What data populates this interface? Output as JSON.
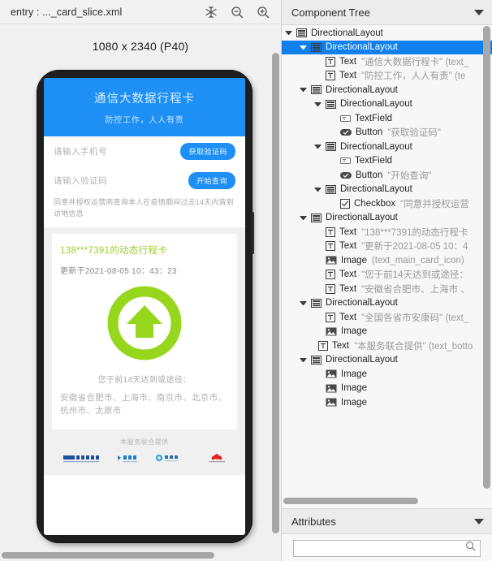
{
  "left_panel": {
    "title": "entry : ..._card_slice.xml",
    "toolbar_icons": [
      {
        "name": "snowflake-icon",
        "label": "snowflake"
      },
      {
        "name": "zoom-out-icon",
        "label": "zoom out"
      },
      {
        "name": "zoom-in-icon",
        "label": "zoom in"
      }
    ],
    "device_label": "1080 x 2340 (P40)",
    "preview": {
      "header_title": "通信大数据行程卡",
      "header_subtitle": "防控工作，人人有责",
      "phone_placeholder": "请输入手机号",
      "get_code_button": "获取验证码",
      "code_placeholder": "请输入验证码",
      "query_button": "开始查询",
      "agreement": "同意并授权运营商查询本人在疫情期间过去14天内曾到访地信息",
      "card_title": "138***7391的动态行程卡",
      "card_updated": "更新于2021-08-05 10：43：23",
      "card_icon": "green-up-arrow-icon",
      "result_text": "您于前14天达到或途径：",
      "cities": "安徽省合肥市、上海市、南京市、北京市、杭州市、太原市",
      "provider_label": "本服务联合提供",
      "logos": [
        "CAICT 中国信通院",
        "中国电信",
        "中国移动",
        "中国联通"
      ]
    }
  },
  "right_panel": {
    "header_title": "Component Tree",
    "attributes_title": "Attributes",
    "attributes_search_value": "",
    "attributes_search_placeholder": "",
    "tree": [
      {
        "indent": 0,
        "arrow": true,
        "icon": "layout",
        "label": "DirectionalLayout",
        "value": "",
        "selected": false
      },
      {
        "indent": 1,
        "arrow": true,
        "icon": "layout",
        "label": "DirectionalLayout",
        "value": "",
        "selected": true
      },
      {
        "indent": 2,
        "arrow": false,
        "icon": "text",
        "label": "Text",
        "value": "\"通信大数据行程卡\" (text_",
        "selected": false
      },
      {
        "indent": 2,
        "arrow": false,
        "icon": "text",
        "label": "Text",
        "value": "\"防控工作，人人有责\" (te",
        "selected": false
      },
      {
        "indent": 1,
        "arrow": true,
        "icon": "layout",
        "label": "DirectionalLayout",
        "value": "",
        "selected": false
      },
      {
        "indent": 2,
        "arrow": true,
        "icon": "layout",
        "label": "DirectionalLayout",
        "value": "",
        "selected": false
      },
      {
        "indent": 3,
        "arrow": false,
        "icon": "field",
        "label": "TextField",
        "value": "",
        "selected": false
      },
      {
        "indent": 3,
        "arrow": false,
        "icon": "button",
        "label": "Button",
        "value": "\"获取验证码\"",
        "selected": false
      },
      {
        "indent": 2,
        "arrow": true,
        "icon": "layout",
        "label": "DirectionalLayout",
        "value": "",
        "selected": false
      },
      {
        "indent": 3,
        "arrow": false,
        "icon": "field",
        "label": "TextField",
        "value": "",
        "selected": false
      },
      {
        "indent": 3,
        "arrow": false,
        "icon": "button",
        "label": "Button",
        "value": "\"开始查询\"",
        "selected": false
      },
      {
        "indent": 2,
        "arrow": true,
        "icon": "layout",
        "label": "DirectionalLayout",
        "value": "",
        "selected": false
      },
      {
        "indent": 3,
        "arrow": false,
        "icon": "check",
        "label": "Checkbox",
        "value": "\"同意并授权运营",
        "selected": false
      },
      {
        "indent": 1,
        "arrow": true,
        "icon": "layout",
        "label": "DirectionalLayout",
        "value": "",
        "selected": false
      },
      {
        "indent": 2,
        "arrow": false,
        "icon": "text",
        "label": "Text",
        "value": "\"138***7391的动态行程卡",
        "selected": false
      },
      {
        "indent": 2,
        "arrow": false,
        "icon": "text",
        "label": "Text",
        "value": "\"更新于2021-08-05 10：4",
        "selected": false
      },
      {
        "indent": 2,
        "arrow": false,
        "icon": "image",
        "label": "Image",
        "value": "(text_main_card_icon)",
        "selected": false
      },
      {
        "indent": 2,
        "arrow": false,
        "icon": "text",
        "label": "Text",
        "value": "\"您于前14天达到或途径：",
        "selected": false
      },
      {
        "indent": 2,
        "arrow": false,
        "icon": "text",
        "label": "Text",
        "value": "\"安徽省合肥市、上海市 、",
        "selected": false
      },
      {
        "indent": 1,
        "arrow": true,
        "icon": "layout",
        "label": "DirectionalLayout",
        "value": "",
        "selected": false
      },
      {
        "indent": 2,
        "arrow": false,
        "icon": "text",
        "label": "Text",
        "value": "\"全国各省市安康码\" (text_",
        "selected": false
      },
      {
        "indent": 2,
        "arrow": false,
        "icon": "image",
        "label": "Image",
        "value": "",
        "selected": false
      },
      {
        "indent": 1.5,
        "arrow": false,
        "icon": "text",
        "label": "Text",
        "value": "\"本服务联合提供\" (text_botto",
        "selected": false
      },
      {
        "indent": 1,
        "arrow": true,
        "icon": "layout",
        "label": "DirectionalLayout",
        "value": "",
        "selected": false
      },
      {
        "indent": 2,
        "arrow": false,
        "icon": "image",
        "label": "Image",
        "value": "",
        "selected": false
      },
      {
        "indent": 2,
        "arrow": false,
        "icon": "image",
        "label": "Image",
        "value": "",
        "selected": false
      },
      {
        "indent": 2,
        "arrow": false,
        "icon": "image",
        "label": "Image",
        "value": "",
        "selected": false
      }
    ]
  },
  "colors": {
    "accent_blue": "#1e90f5",
    "selection_blue": "#1080ee",
    "card_green": "#9bd12a",
    "panel_grey": "#f2f2f2"
  }
}
